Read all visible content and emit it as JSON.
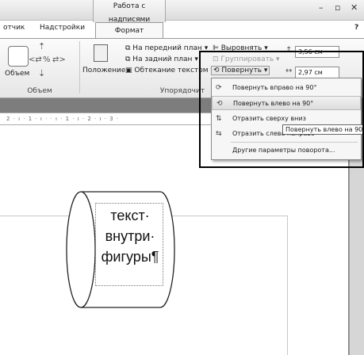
{
  "window": {
    "context_group": "Работа с надписями",
    "controls": [
      "–",
      "▫",
      "✕"
    ]
  },
  "tabs": {
    "tab_left_cut": "отчик",
    "tab_addins": "Надстройки",
    "tab_format": "Формат",
    "help": "?"
  },
  "ribbon": {
    "volume_group": {
      "label": "Объем",
      "button": "Объем"
    },
    "arrange_group": {
      "label": "Упорядочит",
      "position": "Положение",
      "bring_front": "На передний план",
      "send_back": "На задний план",
      "wrap_text": "Обтекание текстом",
      "align": "Выровнять",
      "group": "Группировать",
      "rotate": "Повернуть"
    },
    "size_group": {
      "height": "3,56 см",
      "width": "2,97 см"
    }
  },
  "ruler": {
    "text": "2 · ı · 1 · ı ·   · ı · 1 · ı · 2 · ı · 3 ·"
  },
  "menu": {
    "items": [
      {
        "label": "Повернуть вправо на 90°",
        "icon": "rotate-right-icon"
      },
      {
        "label": "Повернуть влево на 90°",
        "icon": "rotate-left-icon"
      },
      {
        "label": "Отразить сверху вниз",
        "icon": "flip-vertical-icon"
      },
      {
        "label": "Отразить слева направо",
        "icon": "flip-horizontal-icon"
      },
      {
        "label": "Другие параметры поворота...",
        "icon": ""
      }
    ]
  },
  "tooltip": "Повернуть влево на 90°",
  "shape": {
    "lines": [
      "текст·",
      "внутри·",
      "фигуры¶"
    ]
  }
}
